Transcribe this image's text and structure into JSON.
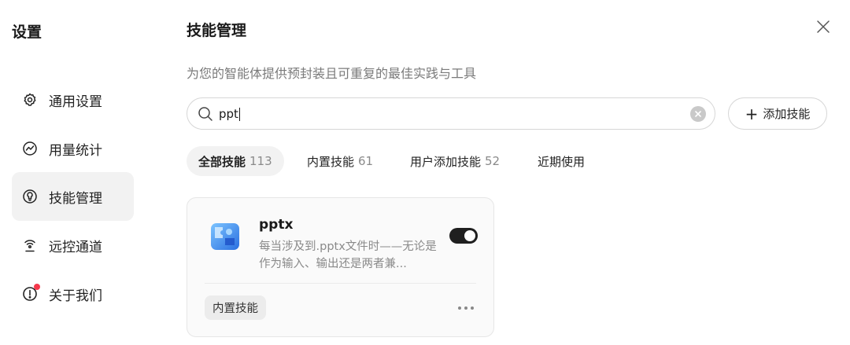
{
  "sidebar": {
    "title": "设置",
    "items": [
      {
        "label": "通用设置",
        "icon": "gear-icon"
      },
      {
        "label": "用量统计",
        "icon": "usage-chart-icon"
      },
      {
        "label": "技能管理",
        "icon": "skill-icon",
        "active": true
      },
      {
        "label": "远控通道",
        "icon": "remote-signal-icon"
      },
      {
        "label": "关于我们",
        "icon": "info-icon",
        "badge": true
      }
    ]
  },
  "header": {
    "title": "技能管理",
    "subtitle": "为您的智能体提供预封装且可重复的最佳实践与工具",
    "close_icon": "close-icon"
  },
  "search": {
    "value": "ppt",
    "icon": "search-icon"
  },
  "add_button": {
    "label": "添加技能",
    "icon": "plus-icon"
  },
  "tabs": [
    {
      "label": "全部技能",
      "count": "113",
      "active": true
    },
    {
      "label": "内置技能",
      "count": "61"
    },
    {
      "label": "用户添加技能",
      "count": "52"
    },
    {
      "label": "近期使用",
      "count": ""
    }
  ],
  "skill_card": {
    "name": "pptx",
    "description": "每当涉及到.pptx文件时——无论是作为输入、输出还是两者兼...",
    "enabled": true,
    "tag": "内置技能",
    "icon": "puzzle-icon"
  },
  "colors": {
    "accent": "#1f1f1f",
    "badge": "#f5384b",
    "active_bg": "#f2f2f2"
  }
}
